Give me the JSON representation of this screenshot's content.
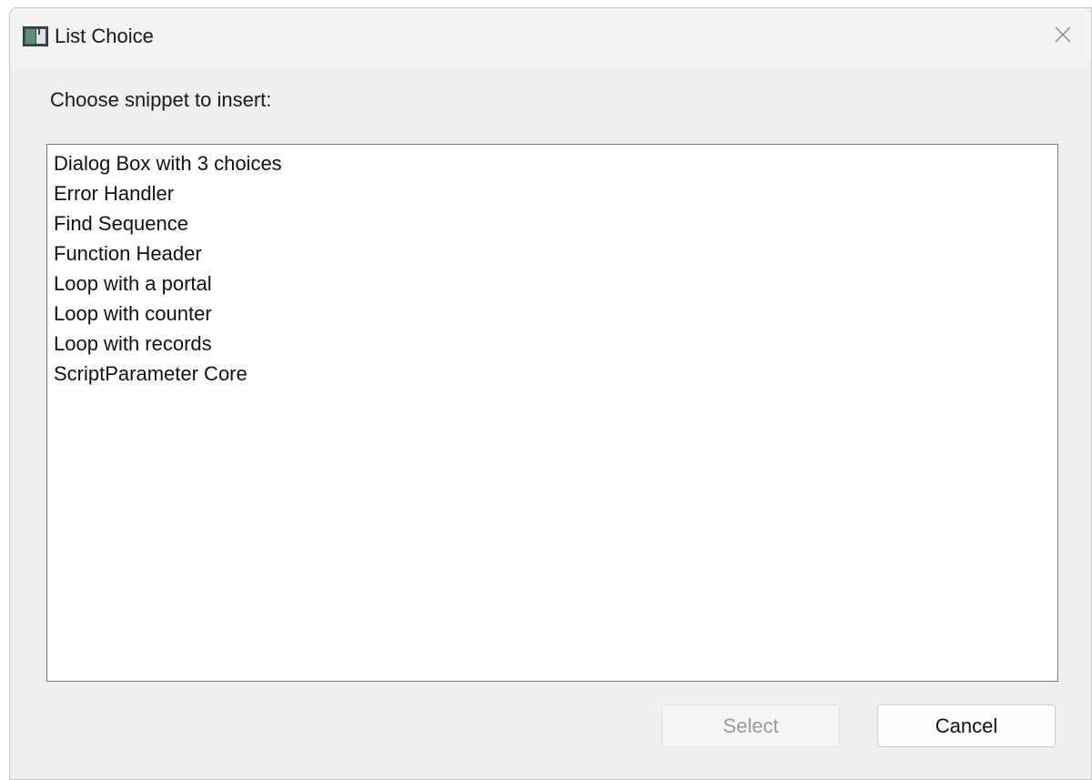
{
  "window": {
    "title": "List Choice",
    "app_icon": "filemaker-app-icon",
    "close_icon": "close-icon"
  },
  "prompt": "Choose snippet to insert:",
  "list": {
    "items": [
      "Dialog Box with 3 choices",
      "Error Handler",
      "Find Sequence",
      "Function Header",
      "Loop with a portal",
      "Loop with counter",
      "Loop with records",
      "ScriptParameter Core"
    ]
  },
  "buttons": {
    "select_label": "Select",
    "select_enabled": false,
    "cancel_label": "Cancel"
  },
  "colors": {
    "dialog_bg": "#efefef",
    "list_bg": "#ffffff",
    "disabled_text": "#9a9a9a"
  }
}
